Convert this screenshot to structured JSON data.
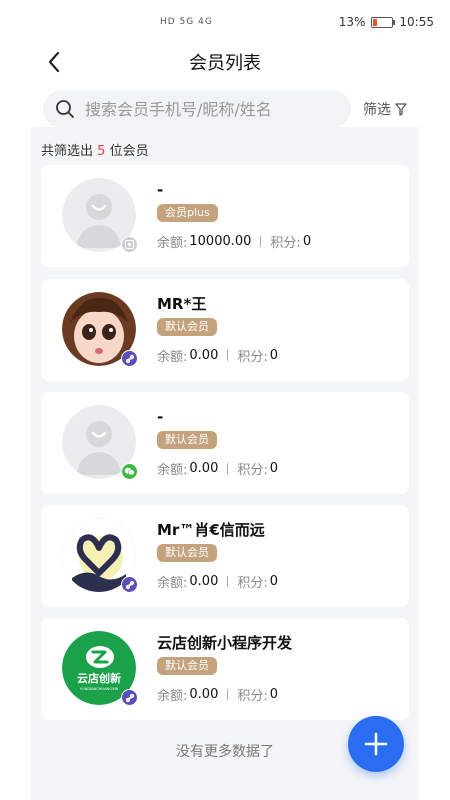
{
  "status_bar": {
    "signal": "HD 5G 4G",
    "battery": "13%",
    "time": "10:55"
  },
  "header": {
    "title": "会员列表"
  },
  "search": {
    "placeholder": "搜索会员手机号/昵称/姓名",
    "filter_label": "筛选"
  },
  "summary": {
    "prefix": "共筛选出",
    "count": "5",
    "suffix": "位会员"
  },
  "members": [
    {
      "name": "-",
      "tag": "会员plus",
      "balance_label": "余额:",
      "balance": "10000.00",
      "points_label": "积分:",
      "points": "0",
      "source_icon": "image-icon"
    },
    {
      "name": "MR*王",
      "tag": "默认会员",
      "balance_label": "余额:",
      "balance": "0.00",
      "points_label": "积分:",
      "points": "0",
      "source_icon": "mini-program-icon"
    },
    {
      "name": "-",
      "tag": "默认会员",
      "balance_label": "余额:",
      "balance": "0.00",
      "points_label": "积分:",
      "points": "0",
      "source_icon": "wechat-icon"
    },
    {
      "name": "Mr™肖€信而远",
      "tag": "默认会员",
      "balance_label": "余额:",
      "balance": "0.00",
      "points_label": "积分:",
      "points": "0",
      "source_icon": "mini-program-icon"
    },
    {
      "name": "云店创新小程序开发",
      "tag": "默认会员",
      "balance_label": "余额:",
      "balance": "0.00",
      "points_label": "积分:",
      "points": "0",
      "source_icon": "mini-program-icon",
      "logo_text": "云店创新",
      "logo_subtext": "YUNDIANCHUANGXIN"
    }
  ],
  "footer": {
    "no_more": "没有更多数据了"
  },
  "colors": {
    "accent": "#2a6df0",
    "tag": "#c4a27e",
    "count": "#e23a3a",
    "mini_program": "#5b4fb8",
    "wechat": "#3fb74b",
    "brand_green": "#1aa14a"
  }
}
